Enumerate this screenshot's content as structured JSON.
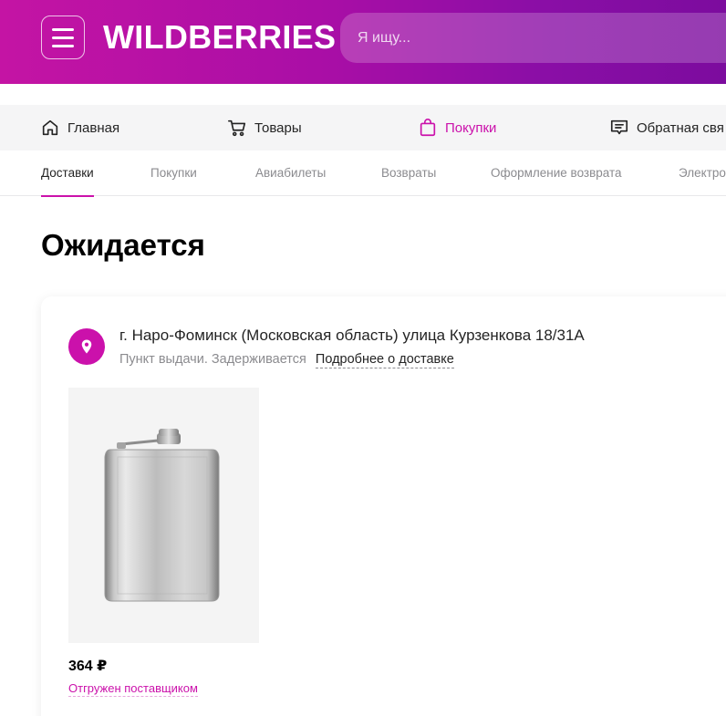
{
  "header": {
    "logo": "WILDBERRIES",
    "search_placeholder": "Я ищу..."
  },
  "topnav": {
    "items": [
      {
        "label": "Главная",
        "icon": "home-icon"
      },
      {
        "label": "Товары",
        "icon": "cart-icon"
      },
      {
        "label": "Покупки",
        "icon": "bag-icon",
        "active": true
      },
      {
        "label": "Обратная свя",
        "icon": "feedback-icon"
      }
    ]
  },
  "subtabs": {
    "items": [
      {
        "label": "Доставки",
        "active": true
      },
      {
        "label": "Покупки"
      },
      {
        "label": "Авиабилеты"
      },
      {
        "label": "Возвраты"
      },
      {
        "label": "Оформление возврата"
      },
      {
        "label": "Электро"
      }
    ]
  },
  "page": {
    "title": "Ожидается"
  },
  "delivery": {
    "address": "г. Наро-Фоминск (Московская область) улица Курзенкова 18/31А",
    "pickup_status": "Пункт выдачи. Задерживается",
    "details_link": "Подробнее о доставке",
    "item": {
      "price": "364 ₽",
      "status": "Отгружен поставщиком"
    }
  },
  "colors": {
    "accent": "#cb11ab",
    "header_gradient_start": "#c414a4",
    "header_gradient_end": "#7c0c9e"
  }
}
